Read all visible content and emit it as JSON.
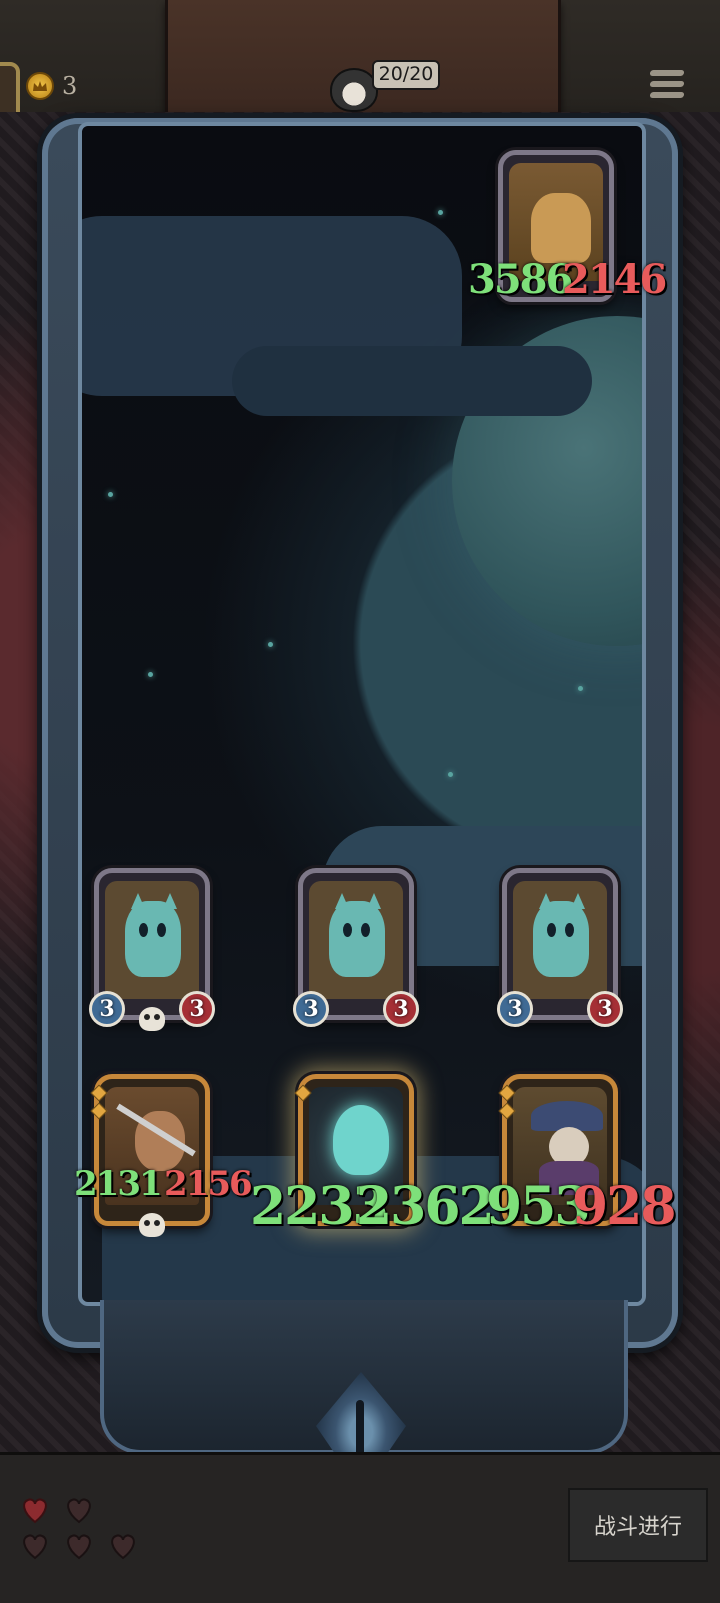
{
  "topbar": {
    "coins": "3",
    "cards_count": "20/20"
  },
  "enemy": {
    "name": "golem",
    "attack": "3586",
    "health": "2146"
  },
  "enemy_row": [
    {
      "attack": "3",
      "health": "3"
    },
    {
      "attack": "3",
      "health": "3"
    },
    {
      "attack": "3",
      "health": "3"
    }
  ],
  "player_row": [
    {
      "attack": "2131",
      "health": "2156"
    },
    {
      "attack": "2233",
      "health": "2362"
    },
    {
      "attack": "953",
      "health": "928"
    }
  ],
  "bottombar": {
    "lives": 5,
    "battle_button": "战斗进行"
  },
  "colors": {
    "attack_text": "#7ee07a",
    "health_text": "#e85b5b",
    "gold_frame": "#c7883a",
    "stone_frame": "#7e7888"
  }
}
